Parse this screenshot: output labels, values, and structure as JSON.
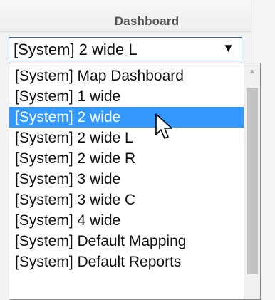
{
  "header": {
    "title": "Dashboard"
  },
  "select": {
    "value": "[System] 2 wide L",
    "arrow_glyph": "▼"
  },
  "options": [
    {
      "label": "[System] Map Dashboard"
    },
    {
      "label": "[System] 1 wide"
    },
    {
      "label": "[System] 2 wide"
    },
    {
      "label": "[System] 2 wide L"
    },
    {
      "label": "[System] 2 wide R"
    },
    {
      "label": "[System] 3 wide"
    },
    {
      "label": "[System] 3 wide C"
    },
    {
      "label": "[System] 4 wide"
    },
    {
      "label": "[System] Default Mapping"
    },
    {
      "label": "[System] Default Reports"
    }
  ],
  "highlighted_option": "[System] 2 wide",
  "scrollbar": {
    "up_glyph": "▲"
  },
  "colors": {
    "highlight": "#3399ff",
    "select_border": "#3c6ec8",
    "header_text": "#555555"
  }
}
